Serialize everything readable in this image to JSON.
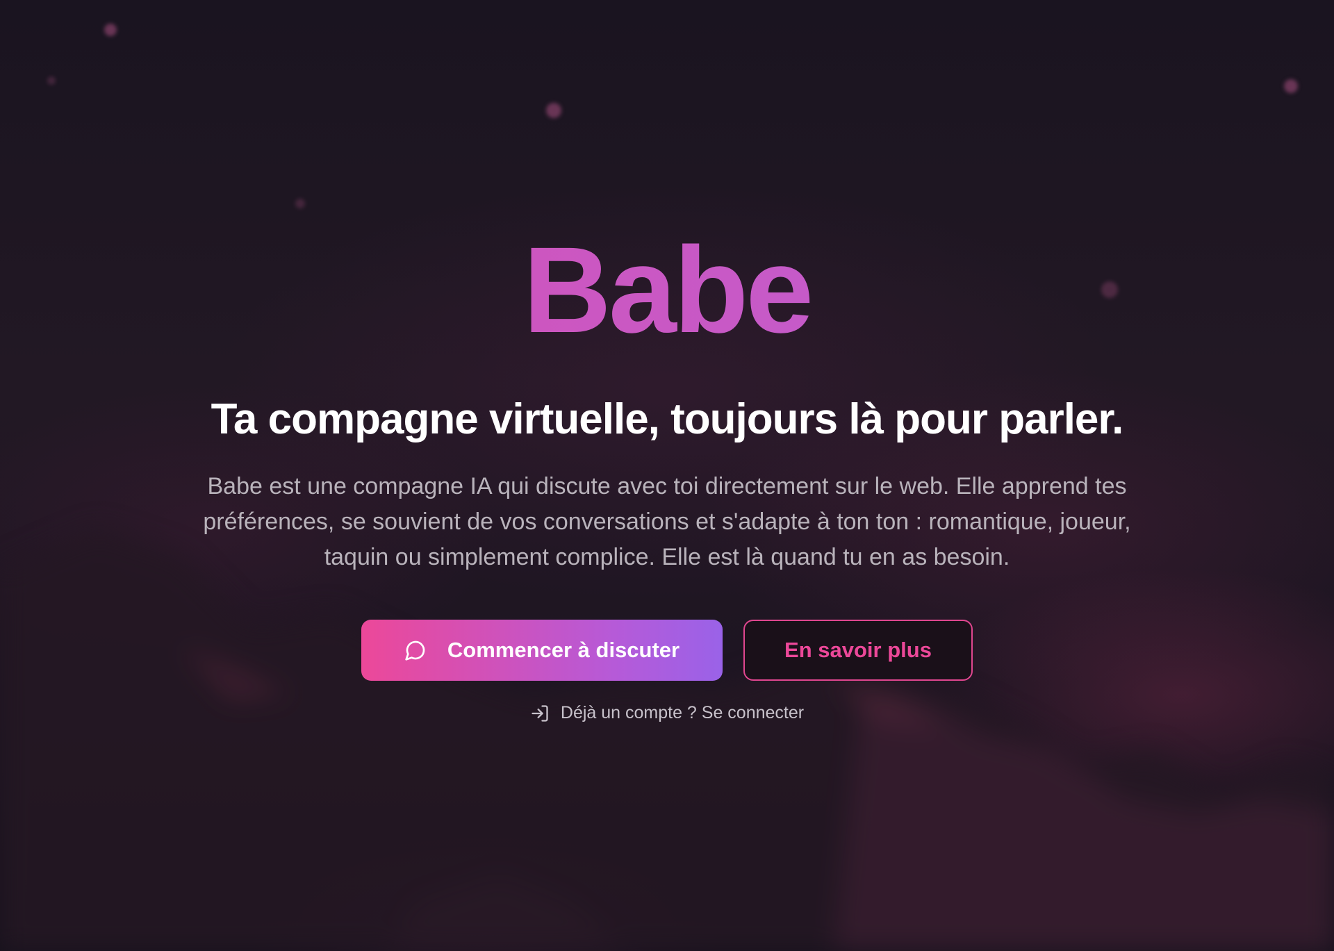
{
  "brand": {
    "name": "Babe"
  },
  "hero": {
    "tagline": "Ta compagne virtuelle, toujours là pour parler.",
    "description": "Babe est une compagne IA qui discute avec toi directement sur le web. Elle apprend tes préférences, se souvient de vos conversations et s'adapte à ton ton : romantique, joueur, taquin ou simplement complice. Elle est là quand tu en as besoin."
  },
  "actions": {
    "primary_label": "Commencer à discuter",
    "primary_icon": "chat-bubble-icon",
    "secondary_label": "En savoir plus"
  },
  "login": {
    "label": "Déjà un compte ? Se connecter",
    "icon": "sign-in-icon"
  },
  "colors": {
    "background": "#17121f",
    "brand_gradient_start": "#d94fb0",
    "brand_gradient_end": "#b85fd6",
    "primary_button_start": "#ec4899",
    "primary_button_end": "#9a62e8",
    "accent_pink": "#ec4899",
    "text_white": "#ffffff",
    "text_muted": "#b9b3bb"
  }
}
